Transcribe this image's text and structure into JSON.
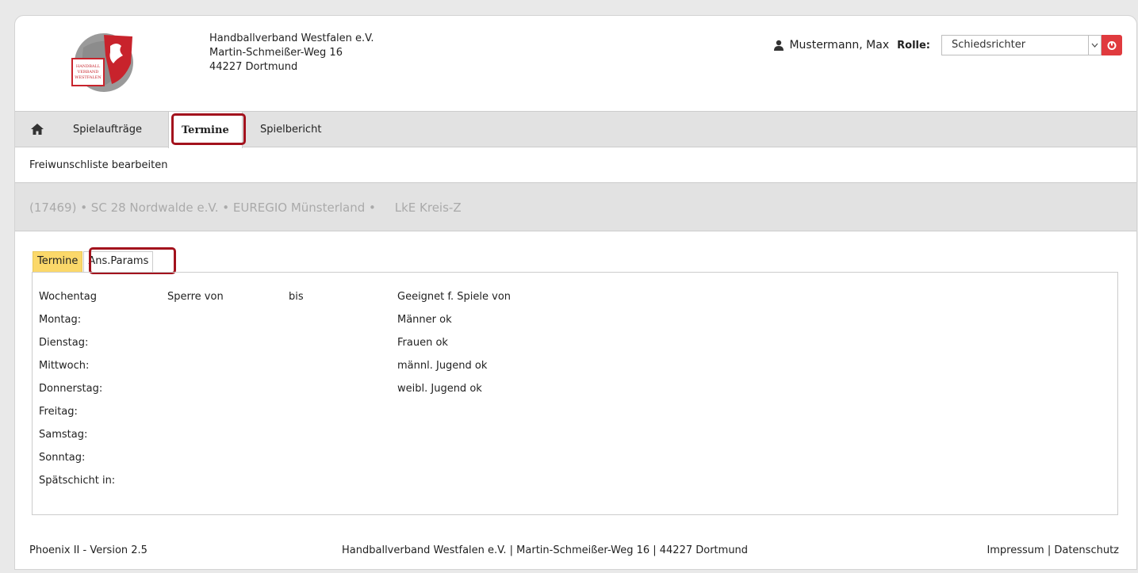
{
  "header": {
    "org_name": "Handballverband Westfalen e.V.",
    "org_street": "Martin-Schmeißer-Weg 16",
    "org_city": "44227 Dortmund",
    "logo_text_1": "HANDBALL",
    "logo_text_2": "VERBAND",
    "logo_text_3": "WESTFALEN",
    "user_name": "Mustermann, Max",
    "role_label": "Rolle:",
    "role_value": "Schiedsrichter"
  },
  "nav": {
    "items": [
      {
        "label": "Spielaufträge"
      },
      {
        "label": "Termine"
      },
      {
        "label": "Spielbericht"
      }
    ]
  },
  "subnav": {
    "label": "Freiwunschliste bearbeiten"
  },
  "club_bar": {
    "text": "(17469) • SC 28 Nordwalde e.V. • EUREGIO Münsterland •     LkE Kreis-Z"
  },
  "tabs": [
    {
      "label": "Termine"
    },
    {
      "label": "Ans.Params"
    }
  ],
  "table": {
    "headers": [
      "Wochentag",
      "Sperre von",
      "bis",
      "Geeignet f. Spiele von"
    ],
    "days": [
      "Montag:",
      "Dienstag:",
      "Mittwoch:",
      "Donnerstag:",
      "Freitag:",
      "Samstag:",
      "Sonntag:",
      "Spätschicht in:"
    ],
    "suitability": [
      "Männer ok",
      "Frauen ok",
      "männl. Jugend ok",
      "weibl. Jugend ok"
    ]
  },
  "footer": {
    "version": "Phoenix II - Version 2.5",
    "address": "Handballverband Westfalen e.V. | Martin-Schmeißer-Weg 16 | 44227 Dortmund",
    "impressum": "Impressum",
    "separator": " | ",
    "datenschutz": "Datenschutz"
  },
  "colors": {
    "accent_red": "#a3121d",
    "logout_red": "#e03a3e",
    "tab_active": "#fbd86a"
  }
}
